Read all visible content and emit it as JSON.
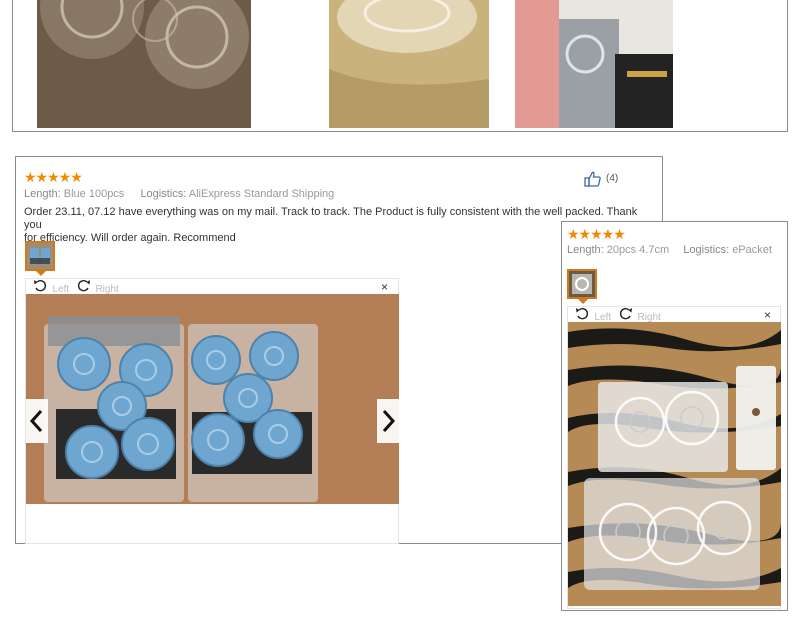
{
  "review_main": {
    "stars": "★★★★★",
    "length_key": "Length:",
    "length_value": "Blue 100pcs",
    "logistics_key": "Logistics:",
    "logistics_value": "AliExpress Standard Shipping",
    "helpful_count": "(4)",
    "text_line1": "Order 23.11, 07.12 have everything was on my mail. Track to track. The Product is fully consistent with the well packed. Thank you",
    "text_line2": "for efficiency. Will order again. Recommend",
    "rotate_left_label": "Left",
    "rotate_right_label": "Right",
    "close_glyph": "×",
    "prev_glyph": "‹",
    "next_glyph": "›"
  },
  "review_second": {
    "stars": "★★★★★",
    "length_key": "Length:",
    "length_value": "20pcs 4.7cm",
    "logistics_key": "Logistics:",
    "logistics_value": "ePacket",
    "rotate_left_label": "Left",
    "rotate_right_label": "Right",
    "close_glyph": "×"
  },
  "colors": {
    "star": "#f08a00",
    "thumb_border": "#d07a1a",
    "frame_border": "#8a8a8a",
    "blue_case": "#6fa6cf",
    "wood": "#b9845a"
  },
  "icons": [
    "thumbs-up-icon",
    "rotate-left-icon",
    "rotate-right-icon",
    "close-icon",
    "chevron-left-icon",
    "chevron-right-icon"
  ]
}
